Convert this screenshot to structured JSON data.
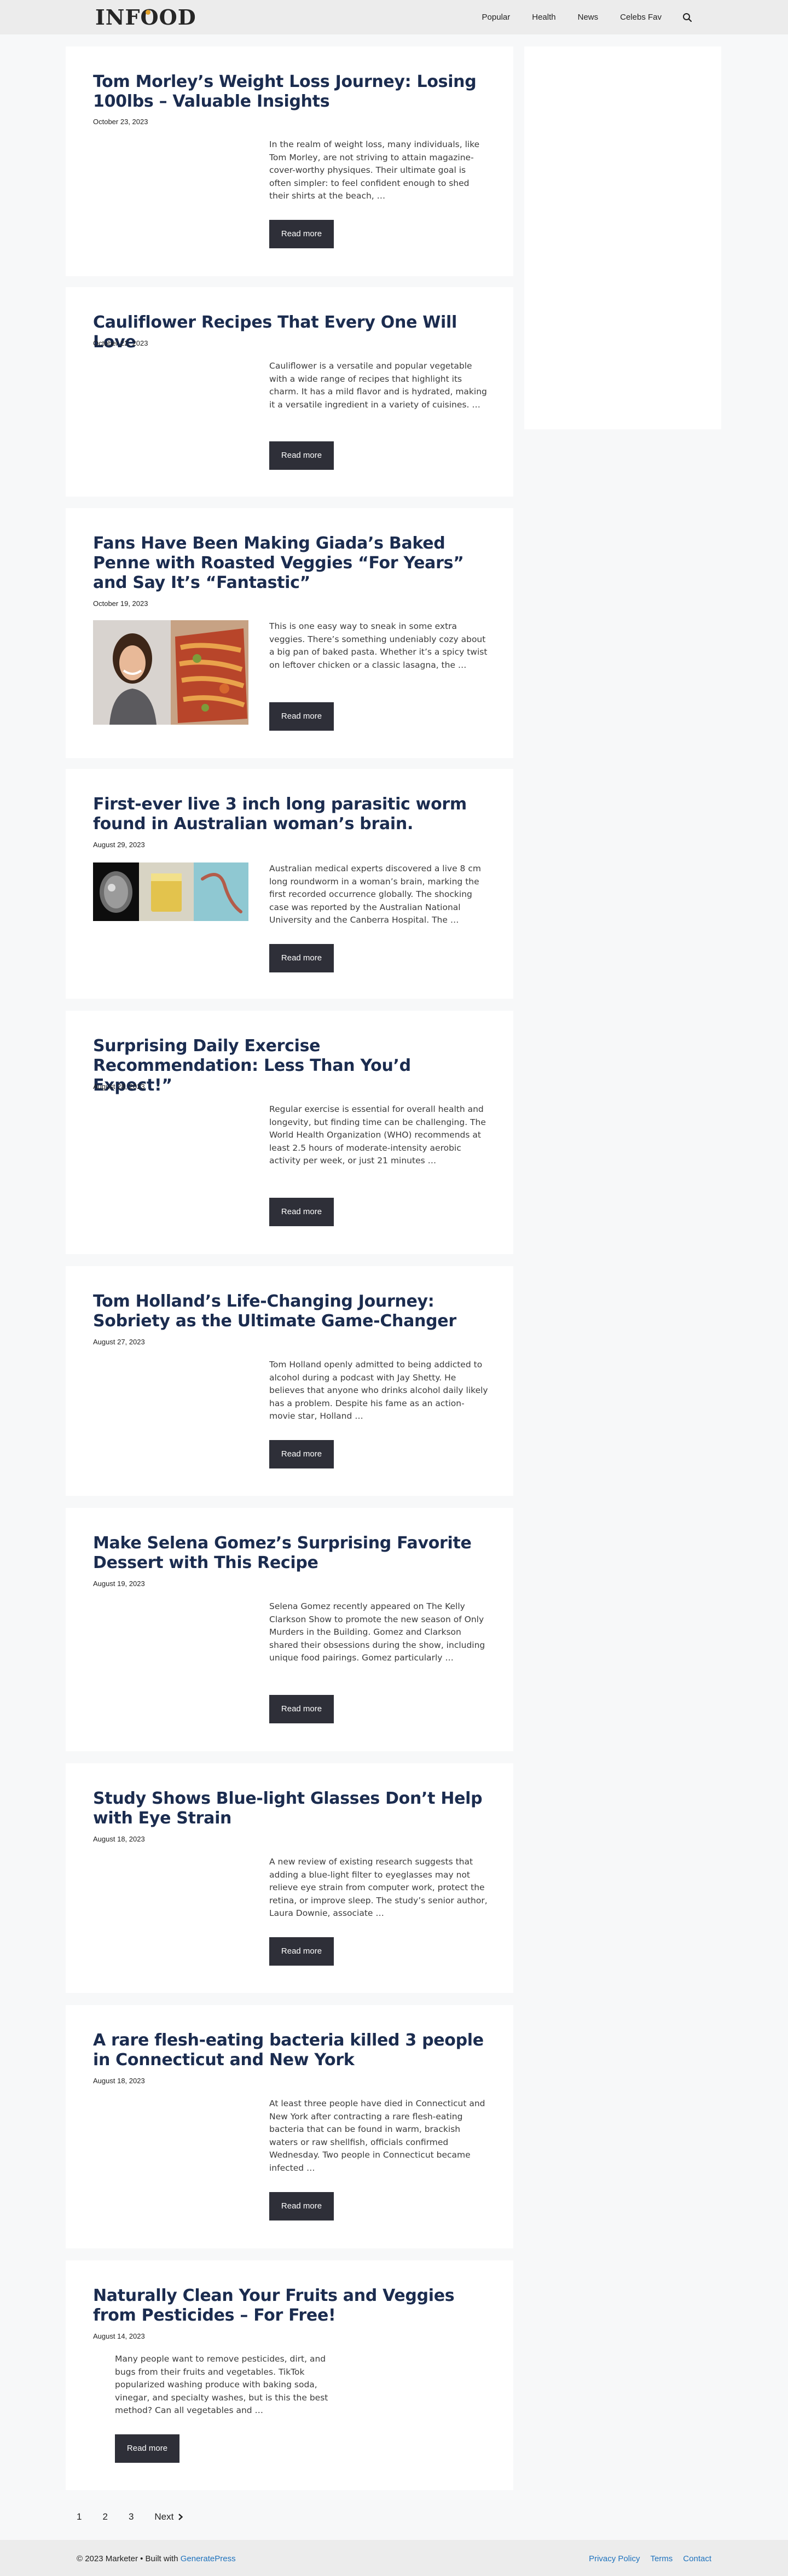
{
  "header": {
    "logo_prefix": "INF",
    "logo_o": "O",
    "logo_suffix": "OD",
    "nav": [
      "Popular",
      "Health",
      "News",
      "Celebs Fav"
    ],
    "search_icon": "search-icon"
  },
  "articles": [
    {
      "title": "Tom Morley’s Weight Loss Journey: Losing 100lbs – Valuable Insights",
      "date": "October 23, 2023",
      "excerpt": "In the realm of weight loss, many individuals, like Tom Morley, are not striving to attain magazine-cover-worthy physiques. Their ultimate goal is often simpler: to feel confident enough to shed their shirts at the beach, …",
      "read_more": "Read more"
    },
    {
      "title": "Cauliflower Recipes That Every One Will Love",
      "date": "October 22, 2023",
      "excerpt": "Cauliflower is a versatile and popular vegetable with a wide range of recipes that highlight its charm. It has a mild flavor and is hydrated, making it a versatile ingredient in a variety of cuisines. …",
      "read_more": "Read more"
    },
    {
      "title": "Fans Have Been Making Giada’s Baked Penne with Roasted Veggies “For Years” and Say It’s “Fantastic”",
      "date": "October 19, 2023",
      "excerpt": "This is one easy way to sneak in some extra veggies. There’s something undeniably cozy about a big pan of baked pasta. Whether it’s a spicy twist on leftover chicken or a classic lasagna, the …",
      "read_more": "Read more"
    },
    {
      "title": "First-ever live 3 inch long parasitic worm found in Australian woman’s brain.",
      "date": "August 29, 2023",
      "excerpt": "Australian medical experts discovered a live 8 cm long roundworm in a woman’s brain, marking the first recorded occurrence globally. The shocking case was reported by the Australian National University and the Canberra Hospital. The …",
      "read_more": "Read more"
    },
    {
      "title": "Surprising Daily Exercise Recommendation: Less Than You’d Expect!”",
      "date": "August 28, 2023",
      "excerpt": "Regular exercise is essential for overall health and longevity, but finding time can be challenging. The World Health Organization (WHO) recommends at least 2.5 hours of moderate-intensity aerobic activity per week, or just 21 minutes …",
      "read_more": "Read more"
    },
    {
      "title": "Tom Holland’s Life-Changing Journey: Sobriety as the Ultimate Game-Changer",
      "date": "August 27, 2023",
      "excerpt": "Tom Holland openly admitted to being addicted to alcohol during a podcast with Jay Shetty. He believes that anyone who drinks alcohol daily likely has a problem. Despite his fame as an action-movie star, Holland …",
      "read_more": "Read more"
    },
    {
      "title": "Make Selena Gomez’s Surprising Favorite Dessert with This Recipe",
      "date": "August 19, 2023",
      "excerpt": "Selena Gomez recently appeared on The Kelly Clarkson Show to promote the new season of Only Murders in the Building. Gomez and Clarkson shared their obsessions during the show, including unique food pairings. Gomez particularly …",
      "read_more": "Read more"
    },
    {
      "title": "Study Shows Blue-light Glasses Don’t Help with Eye Strain",
      "date": "August 18, 2023",
      "excerpt": "A new review of existing research suggests that adding a blue-light filter to eyeglasses may not relieve eye strain from computer work, protect the retina, or improve sleep. The study’s senior author, Laura Downie, associate …",
      "read_more": "Read more"
    },
    {
      "title": "A rare flesh-eating bacteria killed 3 people in Connecticut and New York",
      "date": "August 18, 2023",
      "excerpt": "At least three people have died in Connecticut and New York after contracting a rare flesh-eating bacteria that can be found in warm, brackish waters or raw shellfish, officials confirmed Wednesday. Two people in Connecticut became infected …",
      "read_more": "Read more"
    },
    {
      "title": "Naturally Clean Your Fruits and Veggies from Pesticides – For Free!",
      "date": "August 14, 2023",
      "excerpt": "Many people want to remove pesticides, dirt, and bugs from their fruits and vegetables. TikTok popularized washing produce with baking soda, vinegar, and specialty washes, but is this the best method? Can all vegetables and …",
      "read_more": "Read more"
    }
  ],
  "pagination": {
    "pages": [
      "1",
      "2",
      "3"
    ],
    "next": "Next"
  },
  "footer": {
    "copyright_prefix": "© 2023 Marketer • Built with ",
    "copyright_link": "GeneratePress",
    "links": [
      "Privacy Policy",
      "Terms",
      "Contact"
    ]
  }
}
